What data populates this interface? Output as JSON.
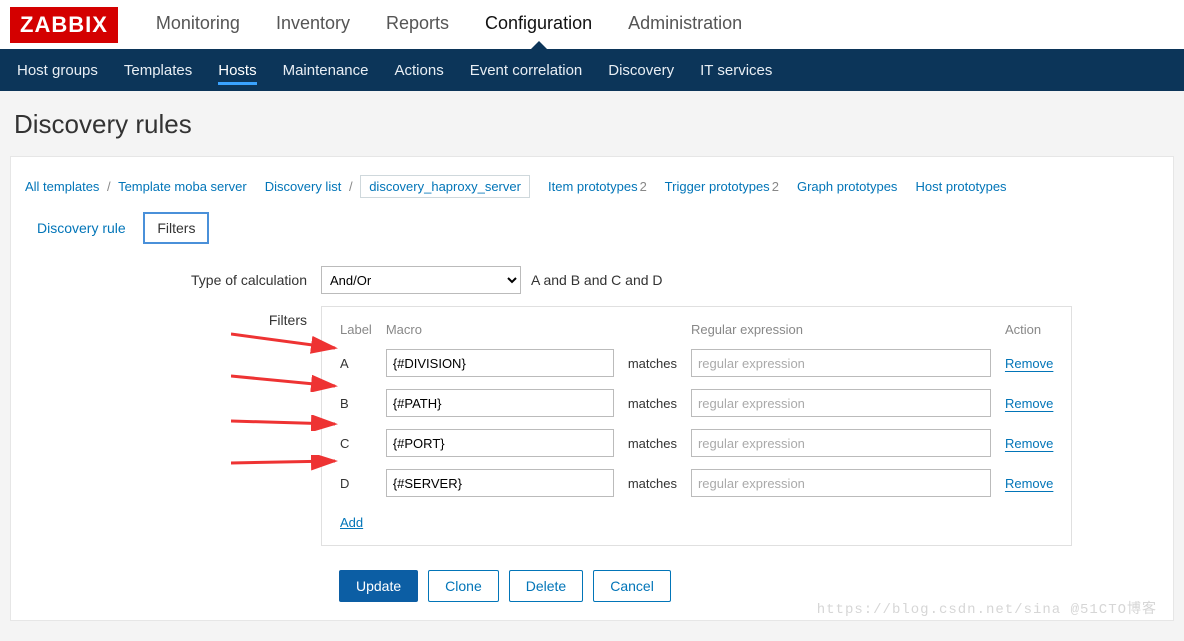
{
  "logo": "ZABBIX",
  "topnav": [
    "Monitoring",
    "Inventory",
    "Reports",
    "Configuration",
    "Administration"
  ],
  "topnav_active": 3,
  "subnav": [
    "Host groups",
    "Templates",
    "Hosts",
    "Maintenance",
    "Actions",
    "Event correlation",
    "Discovery",
    "IT services"
  ],
  "subnav_active": 2,
  "page_title": "Discovery rules",
  "breadcrumbs": {
    "all_templates": "All templates",
    "template": "Template moba server",
    "discovery_list": "Discovery list",
    "current": "discovery_haproxy_server"
  },
  "proto_links": {
    "item": {
      "label": "Item prototypes",
      "count": "2"
    },
    "trigger": {
      "label": "Trigger prototypes",
      "count": "2"
    },
    "graph": {
      "label": "Graph prototypes"
    },
    "host": {
      "label": "Host prototypes"
    }
  },
  "tabs": {
    "rule": "Discovery rule",
    "filters": "Filters"
  },
  "form": {
    "type_label": "Type of calculation",
    "type_value": "And/Or",
    "expression": "A and B and C and D",
    "filters_label": "Filters",
    "head": {
      "label": "Label",
      "macro": "Macro",
      "regex": "Regular expression",
      "action": "Action"
    },
    "matches": "matches",
    "regex_placeholder": "regular expression",
    "remove": "Remove",
    "add": "Add",
    "rows": [
      {
        "label": "A",
        "macro": "{#DIVISION}",
        "regex": ""
      },
      {
        "label": "B",
        "macro": "{#PATH}",
        "regex": ""
      },
      {
        "label": "C",
        "macro": "{#PORT}",
        "regex": ""
      },
      {
        "label": "D",
        "macro": "{#SERVER}",
        "regex": ""
      }
    ]
  },
  "buttons": {
    "update": "Update",
    "clone": "Clone",
    "delete": "Delete",
    "cancel": "Cancel"
  },
  "watermark": "https://blog.csdn.net/sina @51CTO博客"
}
